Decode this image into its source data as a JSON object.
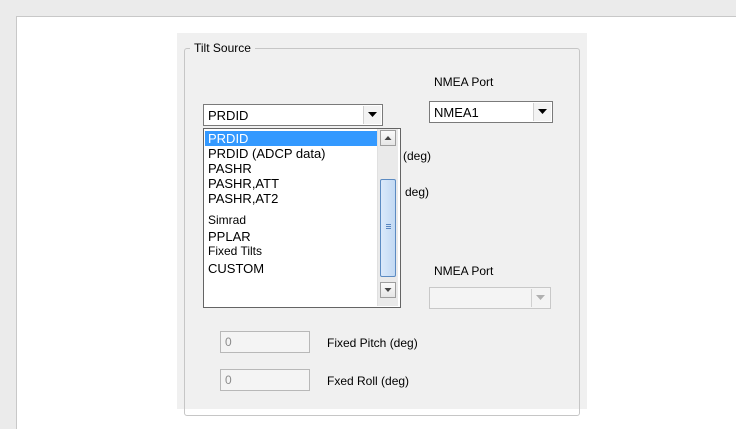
{
  "group": {
    "title": "Tilt Source"
  },
  "nmea_port_label_top": "NMEA Port",
  "nmea_port_label_bottom": "NMEA Port",
  "tilt_source_combo": {
    "value": "PRDID"
  },
  "nmea_port_combo": {
    "value": "NMEA1"
  },
  "partial_labels": {
    "pitch": "(deg)",
    "roll": "deg)"
  },
  "dropdown": {
    "options": [
      {
        "label": "PRDID",
        "selected": true
      },
      {
        "label": "PRDID (ADCP data)",
        "selected": false
      },
      {
        "label": "PASHR",
        "selected": false
      },
      {
        "label": "PASHR,ATT",
        "selected": false
      },
      {
        "label": "PASHR,AT2",
        "selected": false
      },
      {
        "label": "Simrad",
        "selected": false
      },
      {
        "label": "PPLAR",
        "selected": false
      },
      {
        "label": "Fixed Tilts",
        "selected": false
      },
      {
        "label": "CUSTOM",
        "selected": false
      }
    ]
  },
  "fixed_pitch": {
    "value": "0",
    "label": "Fixed Pitch (deg)"
  },
  "fixed_roll": {
    "value": "0",
    "label": "Fxed Roll (deg)"
  },
  "colors": {
    "selection": "#3399ff",
    "dialog_bg": "#f0f0f0"
  },
  "icons": {
    "combo_button": "chevron-down-icon",
    "scroll_up": "arrow-up-icon",
    "scroll_down": "arrow-down-icon"
  }
}
